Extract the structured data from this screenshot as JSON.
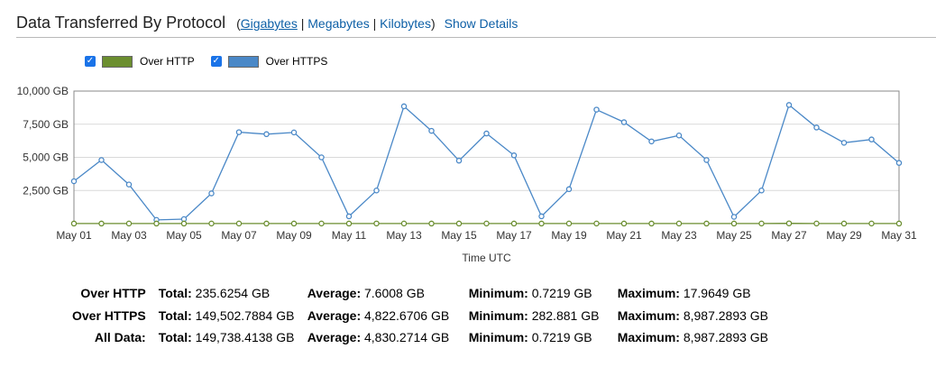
{
  "header": {
    "title": "Data Transferred By Protocol",
    "paren_open": "(",
    "paren_close": ")",
    "separator": "|",
    "units": [
      "Gigabytes",
      "Megabytes",
      "Kilobytes"
    ],
    "selected_unit": "Gigabytes",
    "show_details": "Show Details"
  },
  "legend": [
    {
      "label": "Over HTTP",
      "color": "#6b8e2f",
      "checked": true
    },
    {
      "label": "Over HTTPS",
      "color": "#4a88c7",
      "checked": true
    }
  ],
  "chart_data": {
    "type": "line",
    "xlabel": "Time UTC",
    "ylabel": "",
    "ylim": [
      0,
      10000
    ],
    "yticks": [
      "2,500 GB",
      "5,000 GB",
      "7,500 GB",
      "10,000 GB"
    ],
    "ytick_values": [
      2500,
      5000,
      7500,
      10000
    ],
    "xtick_labels": [
      "May 01",
      "May 03",
      "May 05",
      "May 07",
      "May 09",
      "May 11",
      "May 13",
      "May 15",
      "May 17",
      "May 19",
      "May 21",
      "May 23",
      "May 25",
      "May 27",
      "May 29",
      "May 31"
    ],
    "x": [
      "May 01",
      "May 02",
      "May 03",
      "May 04",
      "May 05",
      "May 06",
      "May 07",
      "May 08",
      "May 09",
      "May 10",
      "May 11",
      "May 12",
      "May 13",
      "May 14",
      "May 15",
      "May 16",
      "May 17",
      "May 18",
      "May 19",
      "May 20",
      "May 21",
      "May 22",
      "May 23",
      "May 24",
      "May 25",
      "May 26",
      "May 27",
      "May 28",
      "May 29",
      "May 30",
      "May 31"
    ],
    "grid": true,
    "series": [
      {
        "name": "Over HTTP",
        "color": "#6b8e2f",
        "values": [
          5,
          6,
          8,
          5,
          7,
          9,
          8,
          6,
          7,
          8,
          5,
          10,
          9,
          7,
          6,
          8,
          7,
          6,
          9,
          8,
          7,
          6,
          8,
          7,
          6,
          8,
          18,
          9,
          7,
          8,
          6
        ]
      },
      {
        "name": "Over HTTPS",
        "color": "#4a88c7",
        "values": [
          3200,
          4800,
          2950,
          280,
          340,
          2280,
          6900,
          6750,
          6880,
          5000,
          550,
          2500,
          8850,
          7000,
          4750,
          6800,
          5150,
          550,
          2600,
          8600,
          7650,
          6200,
          6650,
          4800,
          510,
          2500,
          8950,
          7250,
          6100,
          6350,
          4580
        ]
      }
    ]
  },
  "stats": {
    "rows": [
      {
        "label": "Over HTTP",
        "total": "235.6254 GB",
        "average": "7.6008 GB",
        "minimum": "0.7219 GB",
        "maximum": "17.9649 GB"
      },
      {
        "label": "Over HTTPS",
        "total": "149,502.7884 GB",
        "average": "4,822.6706 GB",
        "minimum": "282.881 GB",
        "maximum": "8,987.2893 GB"
      },
      {
        "label": "All Data:",
        "total": "149,738.4138 GB",
        "average": "4,830.2714 GB",
        "minimum": "0.7219 GB",
        "maximum": "8,987.2893 GB"
      }
    ],
    "labels": {
      "total": "Total:",
      "average": "Average:",
      "minimum": "Minimum:",
      "maximum": "Maximum:"
    }
  }
}
